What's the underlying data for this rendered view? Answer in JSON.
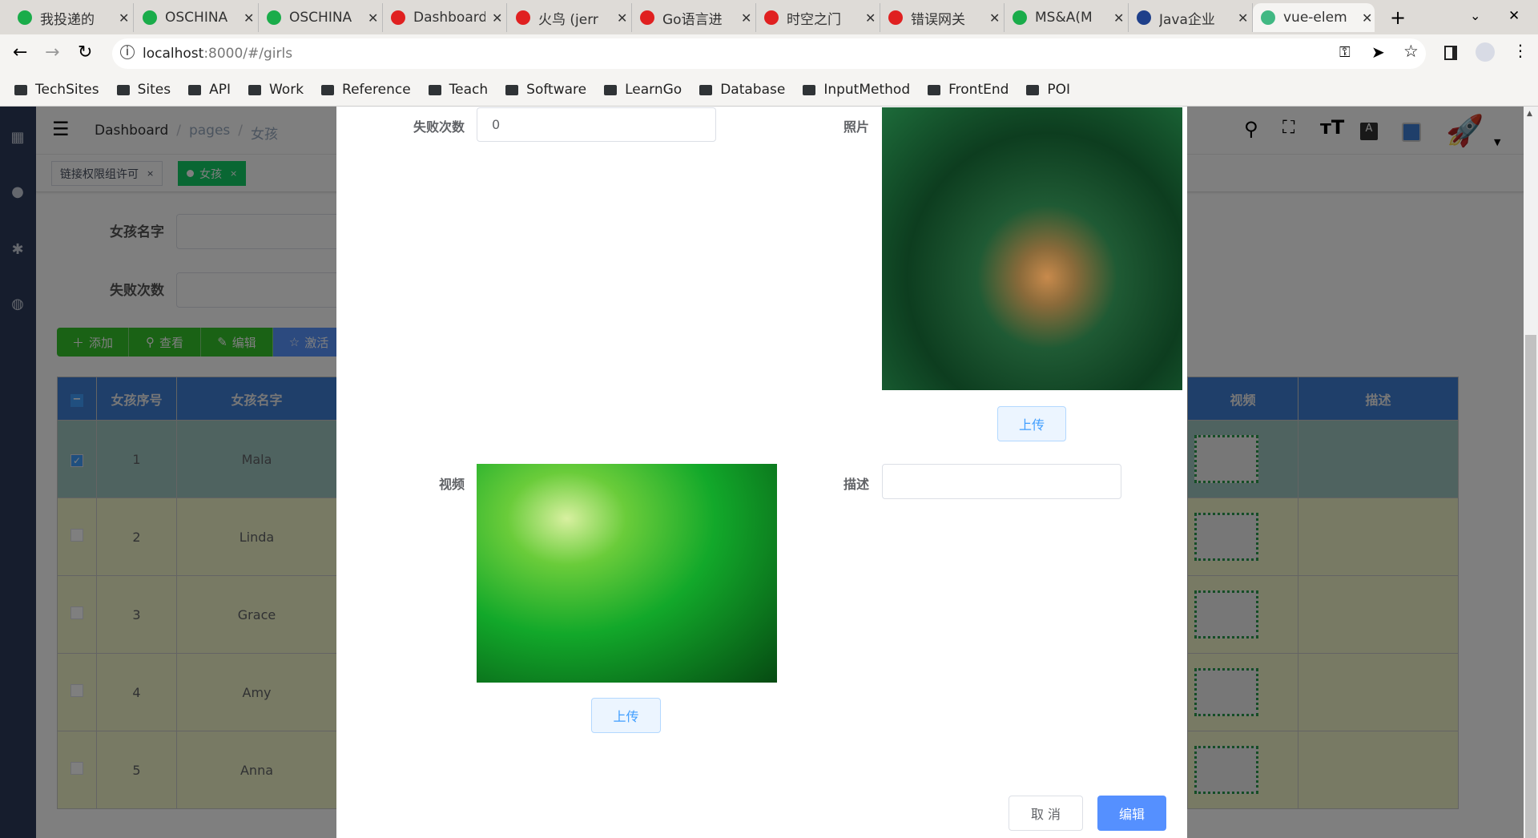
{
  "browser": {
    "tabs": [
      {
        "title": "我投递的",
        "icon": "oschina-icon",
        "color": "#1aac4a"
      },
      {
        "title": "OSCHINA",
        "icon": "oschina-icon",
        "color": "#1aac4a"
      },
      {
        "title": "OSCHINA",
        "icon": "oschina-icon",
        "color": "#1aac4a"
      },
      {
        "title": "Dashboard",
        "icon": "gitee-icon",
        "color": "#e02020"
      },
      {
        "title": "火鸟 (jerr",
        "icon": "gitee-icon",
        "color": "#e02020"
      },
      {
        "title": "Go语言进",
        "icon": "gitee-icon",
        "color": "#e02020"
      },
      {
        "title": "时空之门",
        "icon": "gitee-icon",
        "color": "#e02020"
      },
      {
        "title": "错误网关",
        "icon": "gitee-icon",
        "color": "#e02020"
      },
      {
        "title": "MS&A(M",
        "icon": "oschina-icon",
        "color": "#1aac4a"
      },
      {
        "title": "Java企业",
        "icon": "java-icon",
        "color": "#1e3f8a"
      },
      {
        "title": "vue-elem",
        "icon": "vue-icon",
        "color": "#41b883"
      }
    ],
    "url_host": "localhost",
    "url_rest": ":8000/#/girls",
    "bookmarks": [
      "TechSites",
      "Sites",
      "API",
      "Work",
      "Reference",
      "Teach",
      "Software",
      "LearnGo",
      "Database",
      "InputMethod",
      "FrontEnd",
      "POI"
    ]
  },
  "navbar": {
    "breadcrumb": [
      "Dashboard",
      "pages",
      "女孩"
    ]
  },
  "tags": [
    {
      "label": "链接权限组许可",
      "active": false
    },
    {
      "label": "女孩",
      "active": true
    }
  ],
  "search": {
    "name_label": "女孩名字",
    "fail_label": "失败次数"
  },
  "ops": [
    {
      "label": "添加",
      "icon": "plus-icon"
    },
    {
      "label": "查看",
      "icon": "search-icon"
    },
    {
      "label": "编辑",
      "icon": "edit-icon"
    },
    {
      "label": "激活",
      "icon": "star-icon"
    }
  ],
  "table": {
    "headers": [
      "女孩序号",
      "女孩名字",
      "视频",
      "描述"
    ],
    "rows": [
      {
        "id": "1",
        "name": "Mala",
        "selected": true
      },
      {
        "id": "2",
        "name": "Linda",
        "selected": false
      },
      {
        "id": "3",
        "name": "Grace",
        "selected": false
      },
      {
        "id": "4",
        "name": "Amy",
        "selected": false
      },
      {
        "id": "5",
        "name": "Anna",
        "selected": false
      }
    ]
  },
  "dialog": {
    "fail_label": "失败次数",
    "fail_value": "0",
    "photo_label": "照片",
    "photo_upload": "上传",
    "video_label": "视频",
    "video_upload": "上传",
    "desc_label": "描述",
    "desc_value": "",
    "cancel": "取 消",
    "confirm": "编辑"
  },
  "colors": {
    "primary": "#409eff",
    "sidebar": "#2c3a5a",
    "table_header": "#3e7ed4",
    "tag_active": "#13ce66"
  }
}
